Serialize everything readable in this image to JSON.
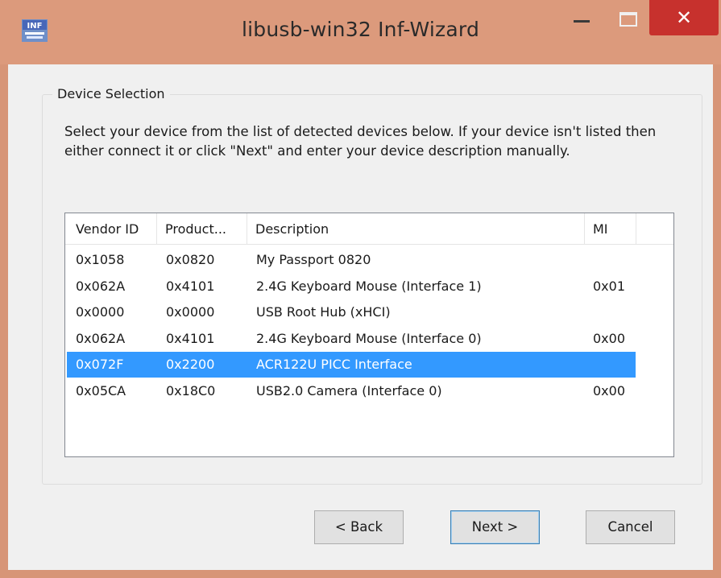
{
  "window": {
    "title": "libusb-win32 Inf-Wizard",
    "icon": "inf-wizard-app-icon",
    "controls": {
      "minimize": "minimize-icon",
      "maximize": "maximize-icon",
      "close_glyph": "✕"
    }
  },
  "group": {
    "label": "Device Selection",
    "instructions": "Select your device from the list of detected devices below. If your device isn't listed then either connect it or click \"Next\" and enter your device description manually."
  },
  "device_list": {
    "columns": [
      "Vendor ID",
      "Product...",
      "Description",
      "MI"
    ],
    "rows": [
      {
        "vendor_id": "0x1058",
        "product_id": "0x0820",
        "description": "My Passport 0820",
        "mi": ""
      },
      {
        "vendor_id": "0x062A",
        "product_id": "0x4101",
        "description": "2.4G Keyboard Mouse (Interface 1)",
        "mi": "0x01"
      },
      {
        "vendor_id": "0x0000",
        "product_id": "0x0000",
        "description": "USB Root Hub (xHCI)",
        "mi": ""
      },
      {
        "vendor_id": "0x062A",
        "product_id": "0x4101",
        "description": "2.4G Keyboard Mouse (Interface 0)",
        "mi": "0x00"
      },
      {
        "vendor_id": "0x072F",
        "product_id": "0x2200",
        "description": "ACR122U PICC Interface",
        "mi": ""
      },
      {
        "vendor_id": "0x05CA",
        "product_id": "0x18C0",
        "description": "USB2.0 Camera (Interface 0)",
        "mi": "0x00"
      }
    ],
    "selected_index": 4,
    "selection_color": "#3399ff"
  },
  "buttons": {
    "back": "< Back",
    "next": "Next >",
    "cancel": "Cancel"
  },
  "colors": {
    "titlebar": "#dc9a7c",
    "close_button": "#c7312d"
  }
}
